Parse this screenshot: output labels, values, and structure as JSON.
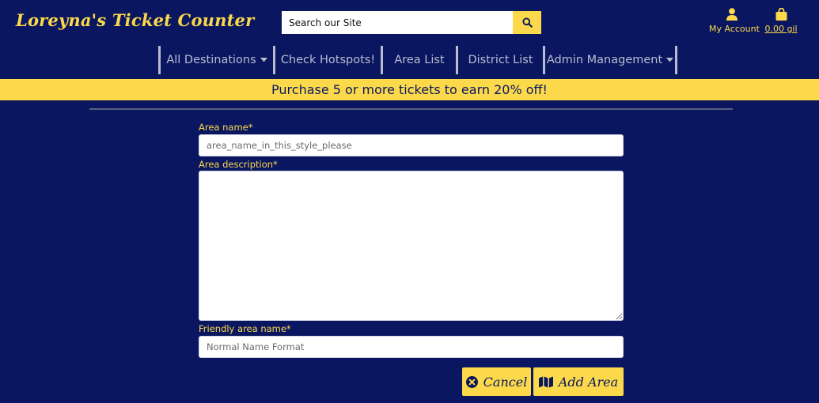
{
  "header": {
    "brand": "Loreyna's Ticket Counter",
    "search": {
      "placeholder": "Search our Site",
      "value": ""
    },
    "account_label": "My Account",
    "bag_total": "0.00 gil"
  },
  "nav": {
    "items": [
      {
        "label": "All Destinations",
        "has_dropdown": true
      },
      {
        "label": "Check Hotspots!",
        "has_dropdown": false
      },
      {
        "label": "Area List",
        "has_dropdown": false
      },
      {
        "label": "District List",
        "has_dropdown": false
      },
      {
        "label": "Admin Management",
        "has_dropdown": true
      }
    ]
  },
  "promo": {
    "text": "Purchase 5 or more tickets to earn 20% off!"
  },
  "form": {
    "area_name": {
      "label": "Area name*",
      "placeholder": "area_name_in_this_style_please",
      "value": ""
    },
    "area_description": {
      "label": "Area description*",
      "placeholder": "",
      "value": ""
    },
    "friendly_name": {
      "label": "Friendly area name*",
      "placeholder": "Normal Name Format",
      "value": ""
    },
    "cancel_label": "Cancel",
    "submit_label": "Add Area"
  },
  "icons": {
    "search": "search-icon",
    "account": "user-icon",
    "bag": "shopping-bag-icon",
    "caret": "caret-down-icon",
    "cancel": "times-circle-icon",
    "map": "map-icon"
  },
  "colors": {
    "background": "#0a1760",
    "accent": "#fcd94b",
    "nav_text": "#b8bcd0"
  }
}
